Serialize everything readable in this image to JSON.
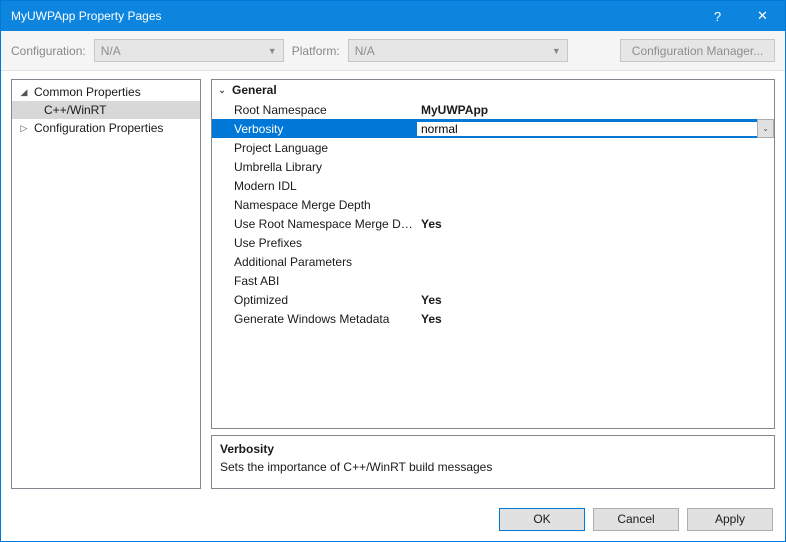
{
  "window": {
    "title": "MyUWPApp Property Pages"
  },
  "toolbar": {
    "config_label": "Configuration:",
    "config_value": "N/A",
    "platform_label": "Platform:",
    "platform_value": "N/A",
    "configmgr_label": "Configuration Manager..."
  },
  "tree": {
    "items": [
      {
        "label": "Common Properties",
        "expanded": true
      },
      {
        "label": "C++/WinRT",
        "selected": true
      },
      {
        "label": "Configuration Properties",
        "expanded": false
      }
    ]
  },
  "grid": {
    "group": "General",
    "props": [
      {
        "name": "Root Namespace",
        "value": "MyUWPApp"
      },
      {
        "name": "Verbosity",
        "value": "normal",
        "selected": true
      },
      {
        "name": "Project Language",
        "value": ""
      },
      {
        "name": "Umbrella Library",
        "value": ""
      },
      {
        "name": "Modern IDL",
        "value": ""
      },
      {
        "name": "Namespace Merge Depth",
        "value": ""
      },
      {
        "name": "Use Root Namespace Merge Depth",
        "value": "Yes"
      },
      {
        "name": "Use Prefixes",
        "value": ""
      },
      {
        "name": "Additional Parameters",
        "value": ""
      },
      {
        "name": "Fast ABI",
        "value": ""
      },
      {
        "name": "Optimized",
        "value": "Yes"
      },
      {
        "name": "Generate Windows Metadata",
        "value": "Yes"
      }
    ]
  },
  "description": {
    "title": "Verbosity",
    "text": "Sets the importance of C++/WinRT build messages"
  },
  "footer": {
    "ok": "OK",
    "cancel": "Cancel",
    "apply": "Apply"
  }
}
